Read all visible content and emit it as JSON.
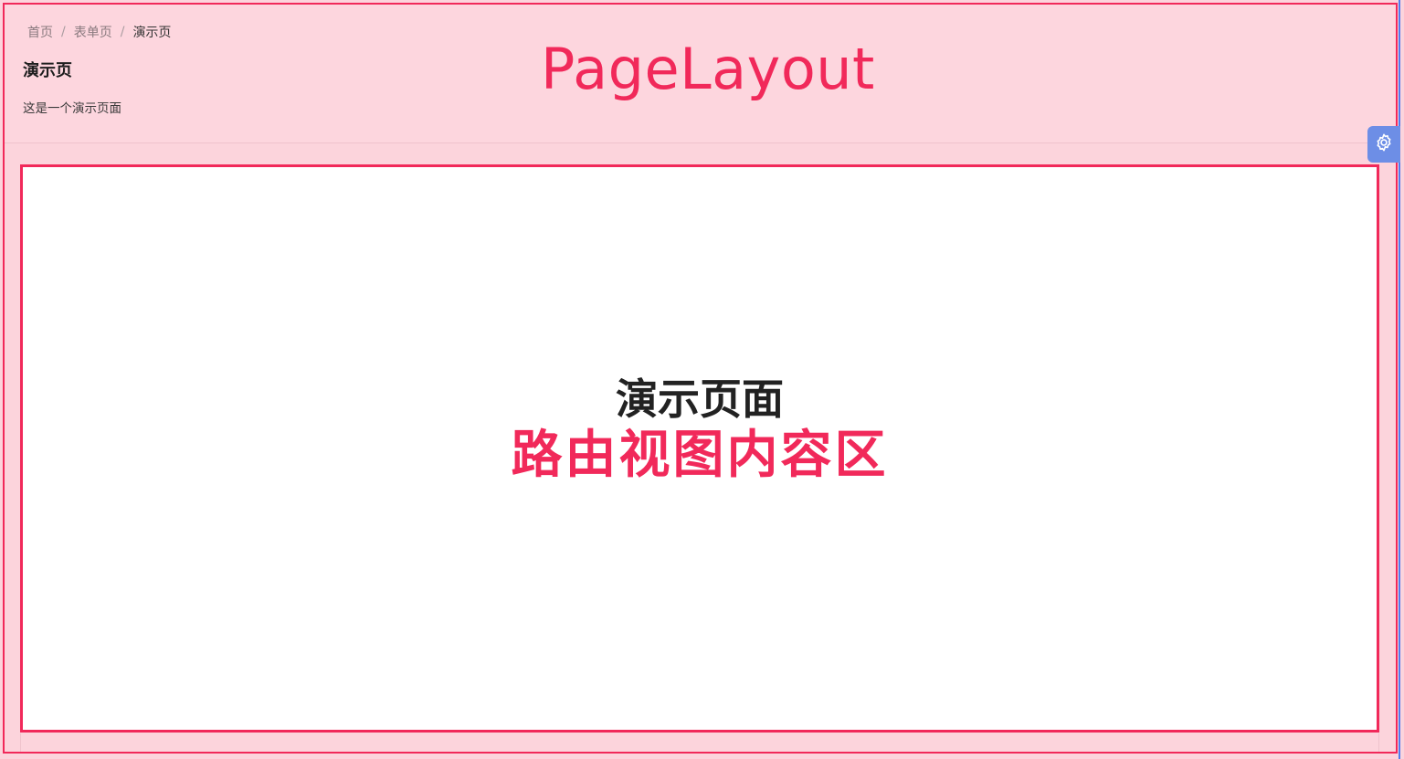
{
  "header": {
    "breadcrumb": [
      {
        "label": "首页"
      },
      {
        "label": "表单页"
      },
      {
        "label": "演示页"
      }
    ],
    "separator": "/",
    "title": "演示页",
    "description": "这是一个演示页面"
  },
  "annotations": {
    "layout_label": "PageLayout",
    "content_label": "路由视图内容区"
  },
  "content": {
    "title": "演示页面"
  },
  "settings": {
    "icon": "gear-icon"
  },
  "colors": {
    "accent": "#f1295a",
    "header_bg": "#fdd6de",
    "settings_bg": "#6d8ee6"
  }
}
